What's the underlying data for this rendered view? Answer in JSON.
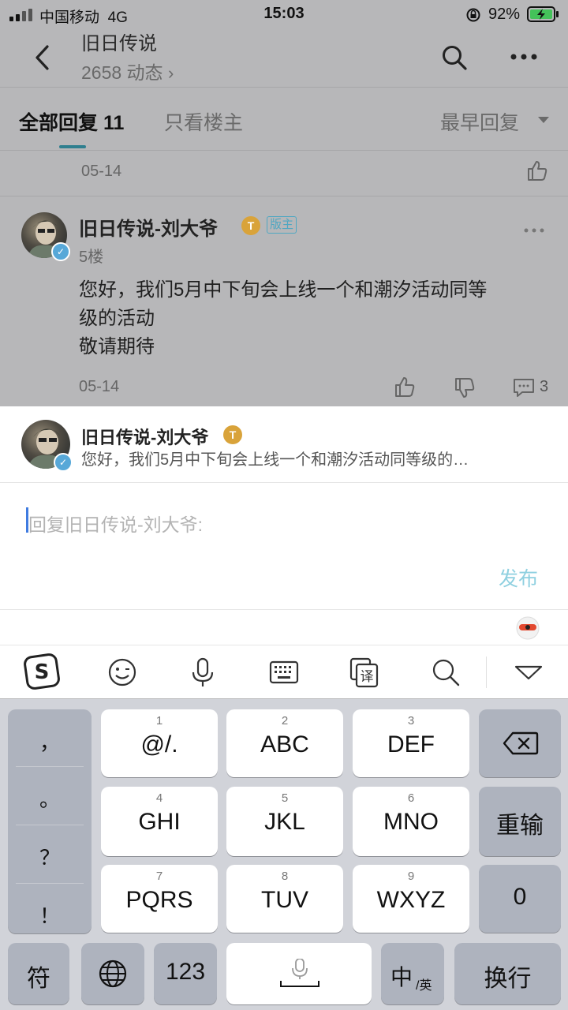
{
  "status_bar": {
    "carrier": "中国移动",
    "network": "4G",
    "time": "15:03",
    "battery": "92%"
  },
  "header": {
    "title": "旧日传说",
    "subtitle": "2658 动态",
    "back_icon": "chevron-left-icon",
    "search_icon": "search-icon",
    "more_icon": "more-icon"
  },
  "tabs": {
    "all_replies": "全部回复",
    "all_count": "11",
    "owner_only": "只看楼主",
    "sort": "最早回复"
  },
  "prev_post": {
    "date": "05-14"
  },
  "post": {
    "author": "旧日传说-刘大爷",
    "badge_letter": "T",
    "role": "版主",
    "floor": "5楼",
    "content_lines": [
      "您好，我们5月中下旬会上线一个和潮汐活动同等",
      "级的活动",
      "敬请期待"
    ],
    "date": "05-14",
    "comment_count": "3"
  },
  "reply_panel": {
    "quote_author": "旧日传说-刘大爷",
    "quote_text": "您好，我们5月中下旬会上线一个和潮汐活动同等级的…",
    "placeholder": "回复旧日传说-刘大爷:",
    "send_label": "发布"
  },
  "keyboard": {
    "punct": [
      "，",
      "。",
      "？",
      "！"
    ],
    "keys": [
      {
        "num": "1",
        "label": "@/."
      },
      {
        "num": "2",
        "label": "ABC"
      },
      {
        "num": "3",
        "label": "DEF"
      },
      {
        "num": "4",
        "label": "GHI"
      },
      {
        "num": "5",
        "label": "JKL"
      },
      {
        "num": "6",
        "label": "MNO"
      },
      {
        "num": "7",
        "label": "PQRS"
      },
      {
        "num": "8",
        "label": "TUV"
      },
      {
        "num": "9",
        "label": "WXYZ"
      }
    ],
    "retype": "重输",
    "zero": "0",
    "symbols": "符",
    "num_mode": "123",
    "lang_main": "中",
    "lang_alt": "/英",
    "enter": "换行"
  }
}
